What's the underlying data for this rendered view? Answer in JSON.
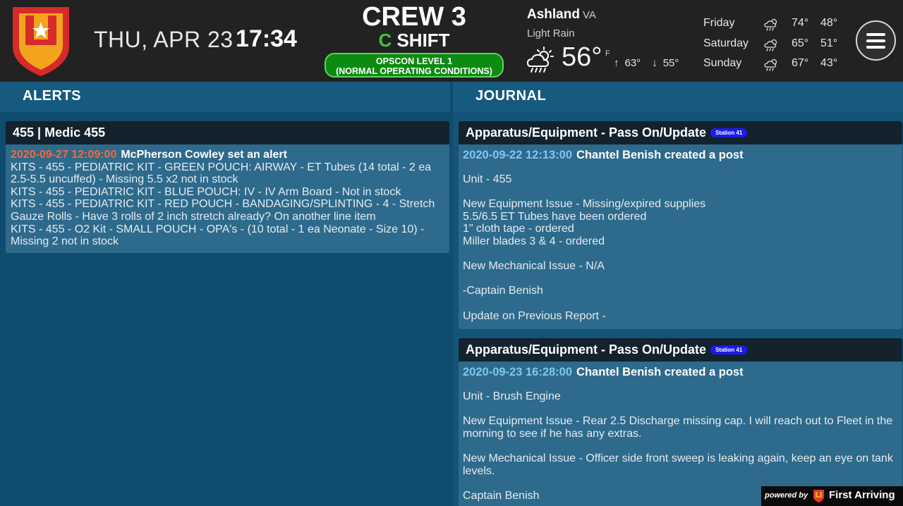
{
  "header": {
    "date": "THU, APR 23",
    "time": "17:34",
    "crew": "CREW 3",
    "shift_letter": "C",
    "shift_word": "SHIFT",
    "opscon_line1": "OPSCON LEVEL 1",
    "opscon_line2": "(NORMAL OPERATING CONDITIONS)",
    "colors": {
      "opscon_bg": "#0d8a12",
      "shift_letter": "#3ec63e"
    }
  },
  "weather": {
    "city": "Ashland",
    "state": "VA",
    "condition": "Light Rain",
    "current_icon": "rain-cloud-sun-icon",
    "temp": "56°",
    "unit": "F",
    "high": "63°",
    "low": "55°",
    "forecast": [
      {
        "day": "Friday",
        "icon": "rain-cloud-sun-icon",
        "high": "74°",
        "low": "48°"
      },
      {
        "day": "Saturday",
        "icon": "rain-cloud-sun-icon",
        "high": "65°",
        "low": "51°"
      },
      {
        "day": "Sunday",
        "icon": "rain-cloud-sun-icon",
        "high": "67°",
        "low": "43°"
      }
    ]
  },
  "sections": {
    "alerts": "ALERTS",
    "journal": "JOURNAL"
  },
  "alerts": [
    {
      "title": "455 | Medic 455",
      "timestamp": "2020-09-27 12:09:00",
      "author": "McPherson Cowley set an alert",
      "lines": [
        "KITS - 455 - PEDIATRIC KIT - GREEN POUCH: AIRWAY - ET Tubes (14 total - 2 ea 2.5-5.5 uncuffed) - Missing 5.5 x2 not in stock",
        "KITS - 455 - PEDIATRIC KIT - BLUE POUCH: IV - IV Arm Board - Not in stock",
        "KITS - 455 - PEDIATRIC KIT - RED POUCH - BANDAGING/SPLINTING - 4 - Stretch Gauze Rolls - Have 3 rolls of 2 inch stretch already? On another line item",
        "KITS - 455 - O2 Kit - SMALL POUCH - OPA's - (10 total - 1 ea Neonate - Size 10) - Missing 2 not in stock"
      ]
    }
  ],
  "journal": [
    {
      "title": "Apparatus/Equipment - Pass On/Update",
      "badge": "Station 41",
      "timestamp": "2020-09-22 12:13:00",
      "author": "Chantel Benish created a post",
      "body": [
        "Unit - 455",
        "",
        "New Equipment Issue - Missing/expired supplies",
        "5.5/6.5 ET Tubes have been ordered",
        "1\" cloth tape - ordered",
        "Miller blades 3 & 4 - ordered",
        "",
        "New Mechanical Issue - N/A",
        "",
        "-Captain Benish",
        "",
        "Update on Previous Report -"
      ]
    },
    {
      "title": "Apparatus/Equipment - Pass On/Update",
      "badge": "Station 41",
      "timestamp": "2020-09-23 16:28:00",
      "author": "Chantel Benish created a post",
      "body": [
        "Unit - Brush Engine",
        "",
        "New Equipment Issue - Rear 2.5 Discharge missing cap. I will reach out to Fleet in the morning to see if he has any extras.",
        "",
        "New Mechanical Issue - Officer side front sweep is leaking again, keep an eye on tank levels.",
        "",
        "Captain Benish"
      ]
    }
  ],
  "footer": {
    "powered_by": "powered by",
    "brand": "First Arriving"
  }
}
